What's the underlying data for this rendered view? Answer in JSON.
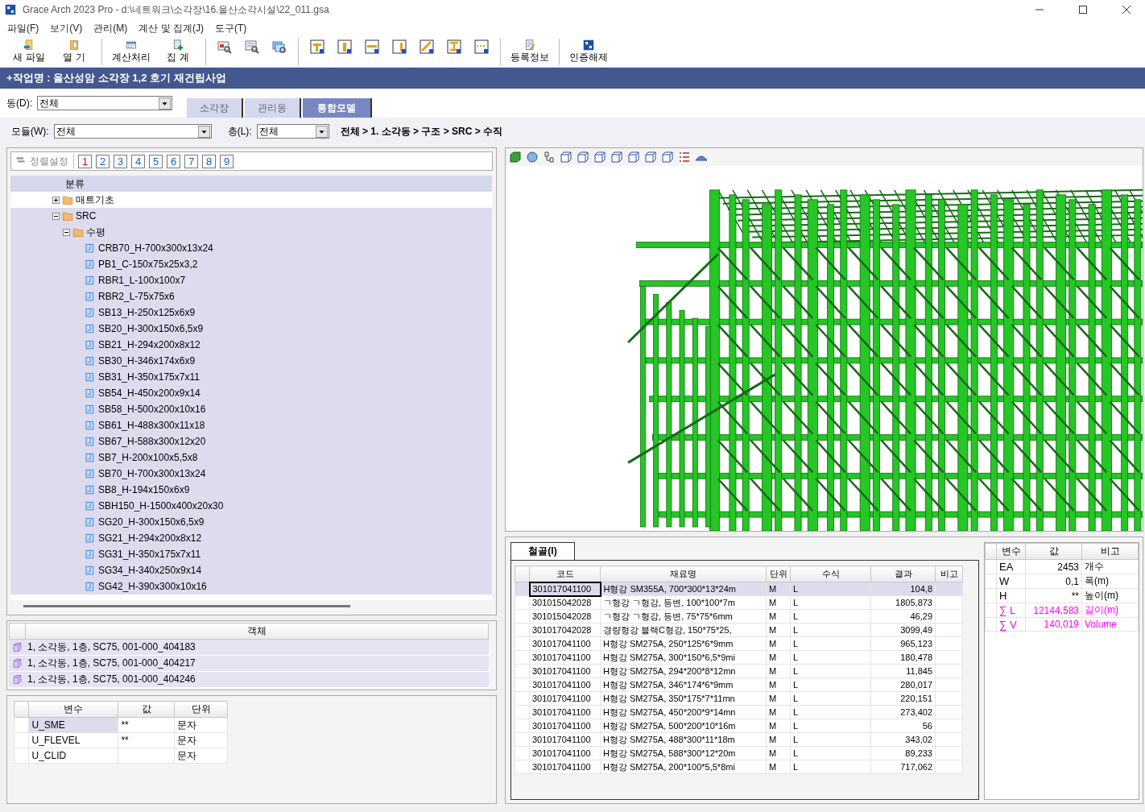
{
  "window": {
    "title": "Grace Arch 2023 Pro - d:\\네트워크\\소각장\\16.울산소각시설\\22_011.gsa"
  },
  "menu": [
    "파일(F)",
    "보기(V)",
    "관리(M)",
    "계산 및 집계(J)",
    "도구(T)"
  ],
  "toolbar": [
    [
      {
        "kind": "new",
        "label": "새 파일"
      },
      {
        "kind": "open",
        "label": "열   기"
      }
    ],
    [
      {
        "kind": "calc",
        "label": "계산처리"
      },
      {
        "kind": "sum",
        "label": "집   계"
      }
    ],
    [
      {
        "kind": "preview"
      },
      {
        "kind": "zoom"
      },
      {
        "kind": "windows"
      }
    ],
    [
      {
        "kind": "frame"
      },
      {
        "kind": "column"
      },
      {
        "kind": "beam"
      },
      {
        "kind": "wall"
      },
      {
        "kind": "brace"
      },
      {
        "kind": "section"
      },
      {
        "kind": "dots"
      }
    ],
    [
      {
        "kind": "register",
        "label": "등록정보"
      }
    ],
    [
      {
        "kind": "auth",
        "label": "인증해제"
      }
    ]
  ],
  "project": "+작업명 : 울산성암 소각장 1,2 호기 재건립사업",
  "building": {
    "label": "동(D):",
    "value": "전체"
  },
  "tabs": [
    {
      "label": "소각장",
      "selected": false
    },
    {
      "label": "관리동",
      "selected": false
    },
    {
      "label": "통합모델",
      "selected": true
    }
  ],
  "module": {
    "label": "모듈(W):",
    "value": "전체"
  },
  "floor": {
    "label": "층(L):",
    "value": "전체"
  },
  "breadcrumb": "전체 > 1. 소각동 > 구조 > SRC > 수직",
  "sort": {
    "label": "정렬설정",
    "levels": [
      {
        "label": "1",
        "selected": true
      },
      {
        "label": "2",
        "selected": false
      },
      {
        "label": "3",
        "selected": false
      },
      {
        "label": "4",
        "selected": false
      },
      {
        "label": "5",
        "selected": false
      },
      {
        "label": "6",
        "selected": false
      },
      {
        "label": "7",
        "selected": false
      },
      {
        "label": "8",
        "selected": false
      },
      {
        "label": "9",
        "selected": false
      }
    ]
  },
  "tree": {
    "header": "분류",
    "items": [
      {
        "label": "매트기초",
        "kind": "folder",
        "expanded": false,
        "selected": false
      },
      {
        "label": "SRC",
        "kind": "folder",
        "expanded": true,
        "selected": true,
        "children": [
          {
            "label": "수평",
            "kind": "folder",
            "expanded": true,
            "selected": true,
            "children": [
              {
                "label": "CRB70_H-700x300x13x24",
                "kind": "section",
                "selected": true
              },
              {
                "label": "PB1_C-150x75x25x3,2",
                "kind": "section",
                "selected": true
              },
              {
                "label": "RBR1_L-100x100x7",
                "kind": "section",
                "selected": true
              },
              {
                "label": "RBR2_L-75x75x6",
                "kind": "section",
                "selected": true
              },
              {
                "label": "SB13_H-250x125x6x9",
                "kind": "section",
                "selected": true
              },
              {
                "label": "SB20_H-300x150x6,5x9",
                "kind": "section",
                "selected": true
              },
              {
                "label": "SB21_H-294x200x8x12",
                "kind": "section",
                "selected": true
              },
              {
                "label": "SB30_H-346x174x6x9",
                "kind": "section",
                "selected": true
              },
              {
                "label": "SB31_H-350x175x7x11",
                "kind": "section",
                "selected": true
              },
              {
                "label": "SB54_H-450x200x9x14",
                "kind": "section",
                "selected": true
              },
              {
                "label": "SB58_H-500x200x10x16",
                "kind": "section",
                "selected": true
              },
              {
                "label": "SB61_H-488x300x11x18",
                "kind": "section",
                "selected": true
              },
              {
                "label": "SB67_H-588x300x12x20",
                "kind": "section",
                "selected": true
              },
              {
                "label": "SB7_H-200x100x5,5x8",
                "kind": "section",
                "selected": true
              },
              {
                "label": "SB70_H-700x300x13x24",
                "kind": "section",
                "selected": true
              },
              {
                "label": "SB8_H-194x150x6x9",
                "kind": "section",
                "selected": true
              },
              {
                "label": "SBH150_H-1500x400x20x30",
                "kind": "section",
                "selected": true
              },
              {
                "label": "SG20_H-300x150x6,5x9",
                "kind": "section",
                "selected": true
              },
              {
                "label": "SG21_H-294x200x8x12",
                "kind": "section",
                "selected": true
              },
              {
                "label": "SG31_H-350x175x7x11",
                "kind": "section",
                "selected": true
              },
              {
                "label": "SG34_H-340x250x9x14",
                "kind": "section",
                "selected": true
              },
              {
                "label": "SG42_H-390x300x10x16",
                "kind": "section",
                "selected": true
              }
            ]
          }
        ]
      }
    ]
  },
  "objects": {
    "header": "객체",
    "rows": [
      "1, 소각동, 1층, SC75, 001-000_404183",
      "1, 소각동, 1층, SC75, 001-000_404217",
      "1, 소각동, 1층, SC75, 001-000_404246"
    ]
  },
  "variables": {
    "columns": [
      "변수",
      "값",
      "단위"
    ],
    "rows": [
      {
        "name": "U_SME",
        "value": "**",
        "unit": "문자",
        "selected": true
      },
      {
        "name": "U_FLEVEL",
        "value": "**",
        "unit": "문자",
        "selected": false
      },
      {
        "name": "U_CLID",
        "unit": "문자",
        "selected": false
      }
    ]
  },
  "steel": {
    "tab": "철골(I)",
    "columns": [
      "코드",
      "재료명",
      "단위",
      "수식",
      "결과",
      "비고"
    ],
    "rows": [
      {
        "code": "301017041100",
        "name": "H형강  SM355A, 700*300*13*24m",
        "unit": "M",
        "formula": "L",
        "result": "104,8",
        "selected": true
      },
      {
        "code": "301015042028",
        "name": "ㄱ형강  ㄱ형강, 등변, 100*100*7m",
        "unit": "M",
        "formula": "L",
        "result": "1805,873",
        "selected": false
      },
      {
        "code": "301015042028",
        "name": "ㄱ형강  ㄱ형강, 등변, 75*75*6mm",
        "unit": "M",
        "formula": "L",
        "result": "46,29",
        "selected": false
      },
      {
        "code": "301017042028",
        "name": "경량형강  블랙C형강, 150*75*25,",
        "unit": "M",
        "formula": "L",
        "result": "3099,49",
        "selected": false
      },
      {
        "code": "301017041100",
        "name": "H형강  SM275A, 250*125*6*9mm",
        "unit": "M",
        "formula": "L",
        "result": "965,123",
        "selected": false
      },
      {
        "code": "301017041100",
        "name": "H형강  SM275A, 300*150*6,5*9mi",
        "unit": "M",
        "formula": "L",
        "result": "180,478",
        "selected": false
      },
      {
        "code": "301017041100",
        "name": "H형강  SM275A, 294*200*8*12mn",
        "unit": "M",
        "formula": "L",
        "result": "11,845",
        "selected": false
      },
      {
        "code": "301017041100",
        "name": "H형강  SM275A, 346*174*6*9mm",
        "unit": "M",
        "formula": "L",
        "result": "280,017",
        "selected": false
      },
      {
        "code": "301017041100",
        "name": "H형강  SM275A, 350*175*7*11mn",
        "unit": "M",
        "formula": "L",
        "result": "220,151",
        "selected": false
      },
      {
        "code": "301017041100",
        "name": "H형강  SM275A, 450*200*9*14mn",
        "unit": "M",
        "formula": "L",
        "result": "273,402",
        "selected": false
      },
      {
        "code": "301017041100",
        "name": "H형강  SM275A, 500*200*10*16m",
        "unit": "M",
        "formula": "L",
        "result": "56",
        "selected": false
      },
      {
        "code": "301017041100",
        "name": "H형강  SM275A, 488*300*11*18m",
        "unit": "M",
        "formula": "L",
        "result": "343,02",
        "selected": false
      },
      {
        "code": "301017041100",
        "name": "H형강  SM275A, 588*300*12*20m",
        "unit": "M",
        "formula": "L",
        "result": "89,233",
        "selected": false
      },
      {
        "code": "301017041100",
        "name": "H형강  SM275A, 200*100*5,5*8mi",
        "unit": "M",
        "formula": "L",
        "result": "717,062",
        "selected": false
      }
    ]
  },
  "summary": {
    "columns": [
      "변수",
      "값",
      "비고"
    ],
    "rows": [
      {
        "name": "EA",
        "value": "2453",
        "note": "개수",
        "color": "#000000"
      },
      {
        "name": "W",
        "value": "0,1",
        "note": "폭(m)",
        "color": "#000000"
      },
      {
        "name": "H",
        "value": "**",
        "note": "높이(m)",
        "color": "#000000"
      },
      {
        "name": "∑ L",
        "value": "12144,583",
        "note": "길이(m)",
        "color": "#ff00ff"
      },
      {
        "name": "∑ V",
        "value": "140,019",
        "note": "Volume",
        "color": "#ff00ff"
      }
    ]
  }
}
